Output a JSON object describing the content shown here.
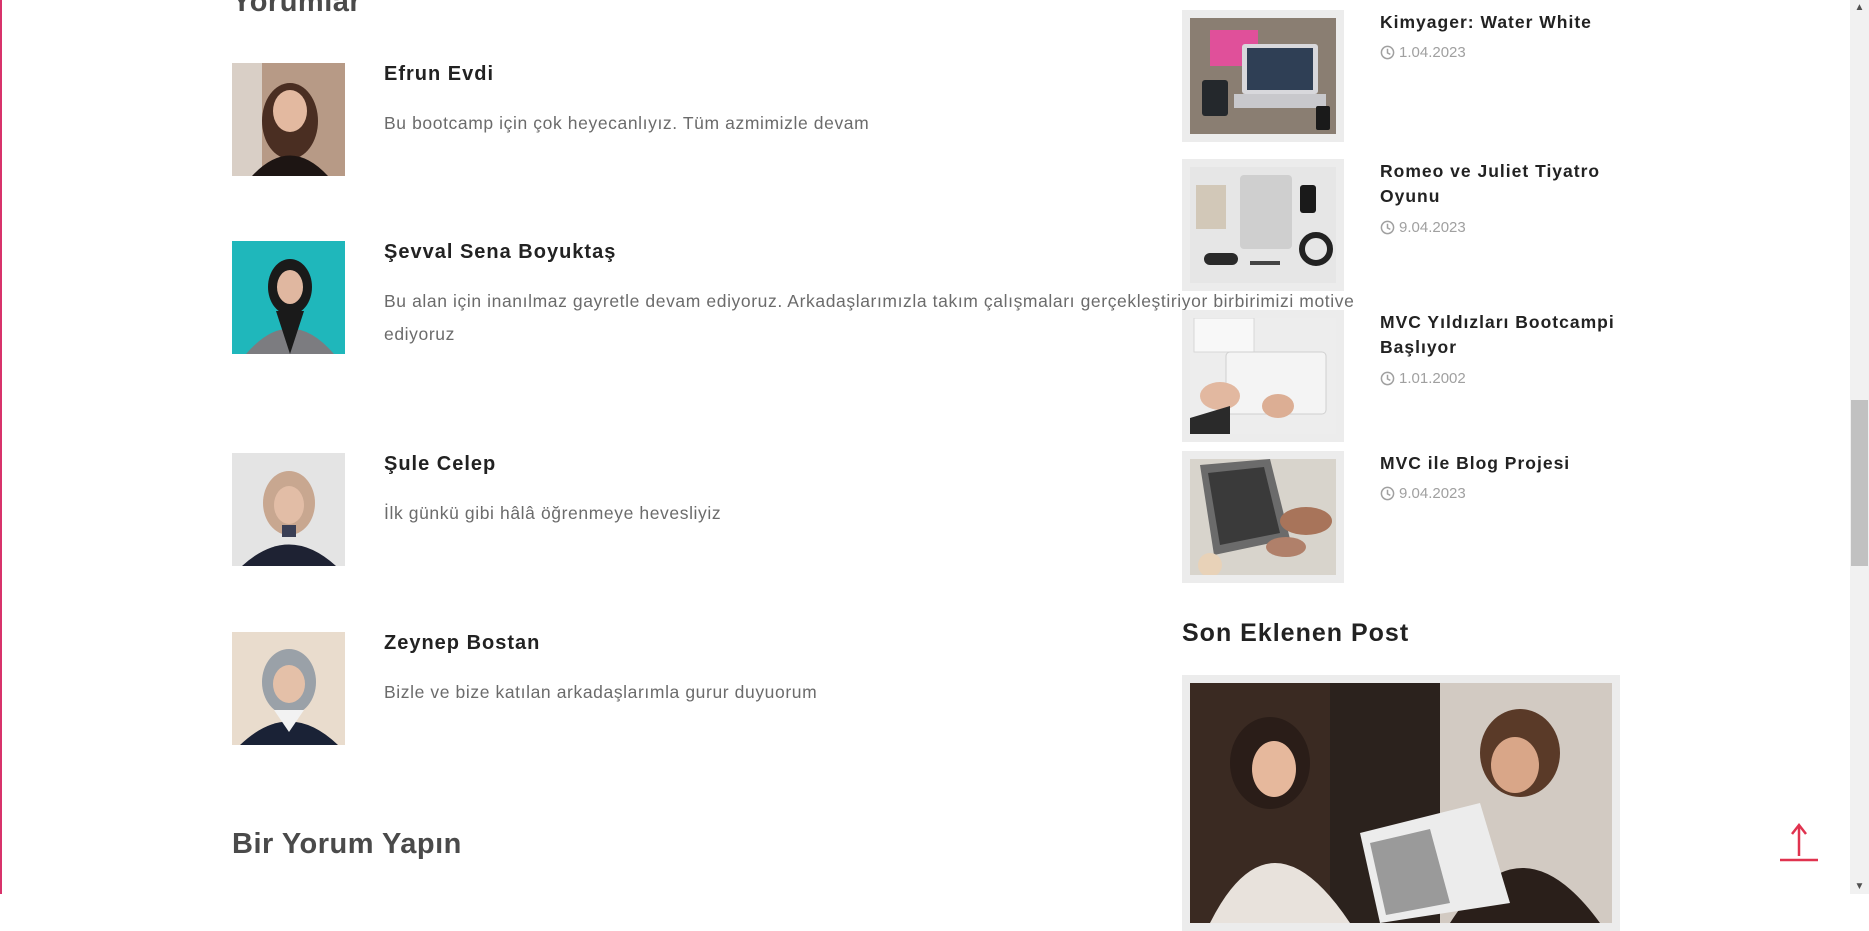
{
  "comments_section": {
    "title": "Yorumlar",
    "items": [
      {
        "name": "Efrun Evdi",
        "text": "Bu bootcamp için çok heyecanlıyız. Tüm azmimizle devam"
      },
      {
        "name": "Şevval Sena Boyuktaş",
        "text": "Bu alan için inanılmaz gayretle devam ediyoruz. Arkadaşlarımızla takım çalışmaları gerçekleştiriyor birbirimizi motive ediyoruz"
      },
      {
        "name": "Şule Celep",
        "text": "İlk günkü gibi hâlâ öğrenmeye hevesliyiz"
      },
      {
        "name": "Zeynep Bostan",
        "text": "Bizle ve bize katılan arkadaşlarımla gurur duyuorum"
      }
    ]
  },
  "comment_form": {
    "title": "Bir Yorum Yapın"
  },
  "sidebar": {
    "posts": [
      {
        "title": "Kimyager: Water White",
        "date": "1.04.2023"
      },
      {
        "title": "Romeo ve Juliet Tiyatro Oyunu",
        "date": "9.04.2023"
      },
      {
        "title": "MVC Yıldızları Bootcampi Başlıyor",
        "date": "1.01.2002"
      },
      {
        "title": "MVC ile Blog Projesi",
        "date": "9.04.2023"
      }
    ],
    "latest_heading": "Son Eklenen Post"
  },
  "colors": {
    "accent": "#e0334f",
    "left_border": "#d8336b"
  }
}
